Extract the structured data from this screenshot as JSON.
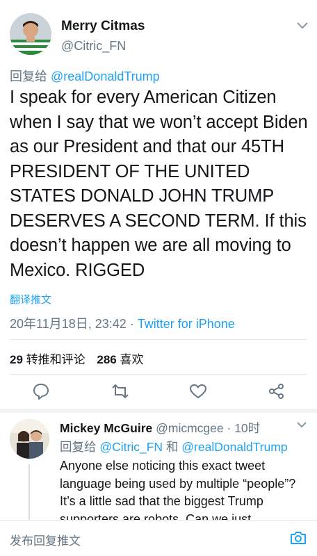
{
  "tweet": {
    "display_name": "Merry Citmas",
    "handle": "@Citric_FN",
    "reply_prefix": "回复给",
    "reply_to": "@realDonaldTrump",
    "text": "I speak for every American Citizen when I say that we won’t accept Biden as our President and that our 45TH PRESIDENT OF THE UNITED STATES DONALD JOHN TRUMP DESERVES A SECOND TERM. If this doesn’t happen we are all moving to Mexico. RIGGED",
    "translate": "翻译推文",
    "timestamp": "20年11月18日, 23:42",
    "separator": " · ",
    "source": "Twitter for iPhone",
    "retweets_count": "29",
    "retweets_label": "转推和评论",
    "likes_count": "286",
    "likes_label": "喜欢"
  },
  "reply": {
    "display_name": "Mickey McGuire",
    "handle": "@micmcgee",
    "time": " · 10时",
    "reply_prefix": "回复给",
    "reply_to_1": "@Citric_FN",
    "and": " 和 ",
    "reply_to_2": "@realDonaldTrump",
    "text": "Anyone else noticing this exact tweet language being used by multiple “people”? It’s a little sad that the biggest Trump supporters are robots. Can we just"
  },
  "composer": {
    "placeholder": "发布回复推文"
  },
  "icons": {
    "menu": "chevron-down-icon",
    "reply": "reply-icon",
    "retweet": "retweet-icon",
    "like": "heart-icon",
    "share": "share-icon",
    "camera": "camera-icon"
  },
  "colors": {
    "accent": "#1da1f2",
    "muted": "#657786",
    "text": "#14171a"
  }
}
